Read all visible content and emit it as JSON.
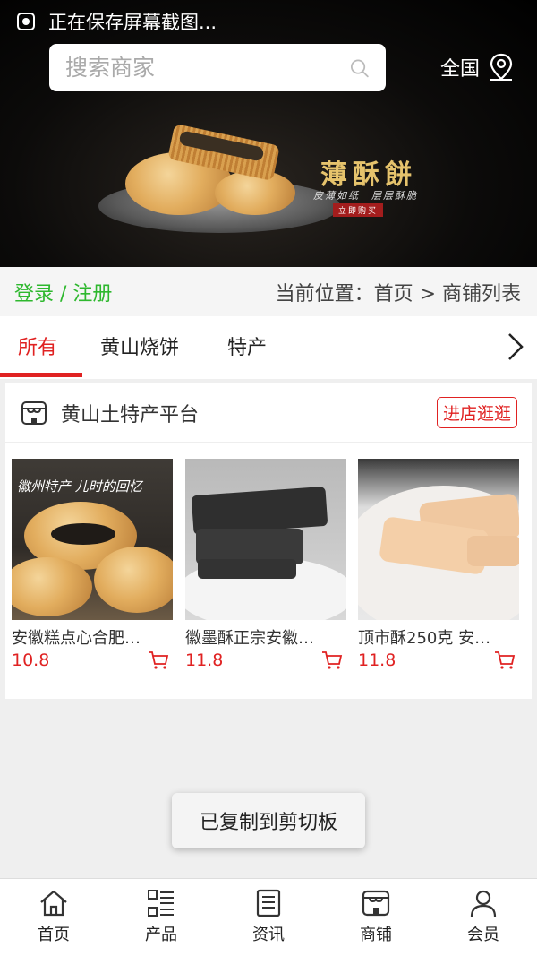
{
  "status": {
    "text": "正在保存屏幕截图..."
  },
  "search": {
    "placeholder": "搜索商家"
  },
  "region": {
    "label": "全国"
  },
  "banner": {
    "title": "薄酥餅",
    "subtitle": "皮薄如纸　层层酥脆",
    "stamp": "立即购买"
  },
  "breadcrumb": {
    "login": "登录 / 注册",
    "path": "当前位置：首页 > 商铺列表"
  },
  "tabs": [
    {
      "label": "所有",
      "active": true
    },
    {
      "label": "黄山烧饼",
      "active": false
    },
    {
      "label": "特产",
      "active": false
    }
  ],
  "shop": {
    "name": "黄山土特产平台",
    "visit_label": "进店逛逛"
  },
  "products": [
    {
      "title": "安徽糕点心合肥…",
      "price": "10.8",
      "image_caption": "徽州特产 儿时的回忆"
    },
    {
      "title": "徽墨酥正宗安徽…",
      "price": "11.8"
    },
    {
      "title": "顶市酥250克 安…",
      "price": "11.8"
    }
  ],
  "toast": {
    "text": "已复制到剪切板"
  },
  "tabbar": [
    {
      "label": "首页",
      "icon": "home-icon"
    },
    {
      "label": "产品",
      "icon": "list-icon"
    },
    {
      "label": "资讯",
      "icon": "news-icon"
    },
    {
      "label": "商铺",
      "icon": "shop-icon"
    },
    {
      "label": "会员",
      "icon": "user-icon"
    }
  ],
  "colors": {
    "accent": "#e02222",
    "login": "#2eb82e"
  }
}
